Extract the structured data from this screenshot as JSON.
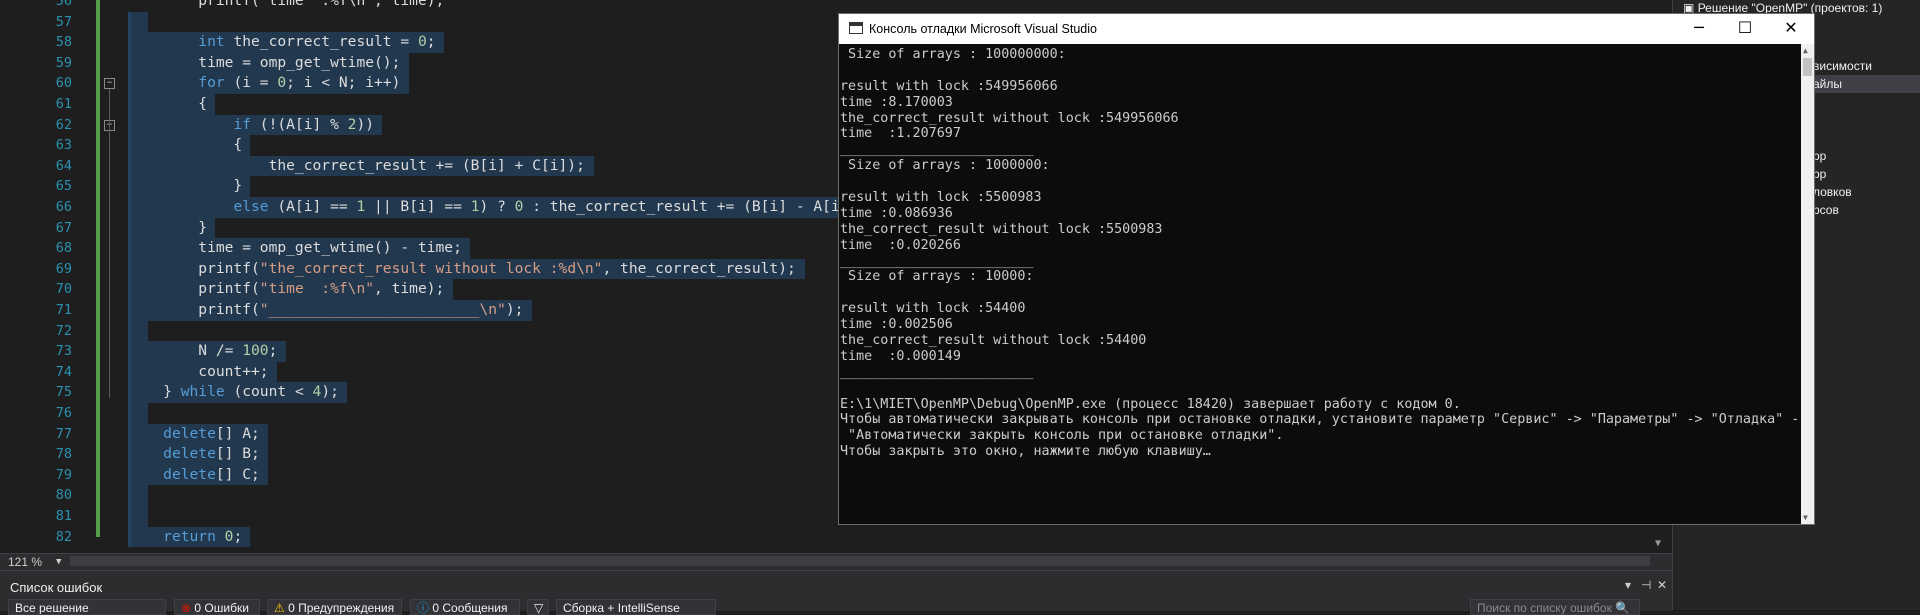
{
  "editor": {
    "lines": [
      {
        "num": "56",
        "segs": [
          {
            "t": "        printf(\"time  :%f\\n\", time);",
            "c": ""
          }
        ]
      },
      {
        "num": "57",
        "segs": [
          {
            "t": "",
            "c": ""
          }
        ]
      },
      {
        "num": "58",
        "segs": [
          {
            "t": "        ",
            "c": ""
          },
          {
            "t": "int",
            "c": "k"
          },
          {
            "t": " the_correct_result = ",
            "c": ""
          },
          {
            "t": "0",
            "c": "n"
          },
          {
            "t": ";",
            "c": ""
          }
        ]
      },
      {
        "num": "59",
        "segs": [
          {
            "t": "        time = omp_get_wtime();",
            "c": ""
          }
        ]
      },
      {
        "num": "60",
        "segs": [
          {
            "t": "        ",
            "c": ""
          },
          {
            "t": "for",
            "c": "k"
          },
          {
            "t": " (i = ",
            "c": ""
          },
          {
            "t": "0",
            "c": "n"
          },
          {
            "t": "; i < N; i++)",
            "c": ""
          }
        ]
      },
      {
        "num": "61",
        "segs": [
          {
            "t": "        {",
            "c": ""
          }
        ]
      },
      {
        "num": "62",
        "segs": [
          {
            "t": "            ",
            "c": ""
          },
          {
            "t": "if",
            "c": "k"
          },
          {
            "t": " (!(A[i] % ",
            "c": ""
          },
          {
            "t": "2",
            "c": "n"
          },
          {
            "t": "))",
            "c": ""
          }
        ]
      },
      {
        "num": "63",
        "segs": [
          {
            "t": "            {",
            "c": ""
          }
        ]
      },
      {
        "num": "64",
        "segs": [
          {
            "t": "                the_correct_result += (B[i] + C[i]);",
            "c": ""
          }
        ]
      },
      {
        "num": "65",
        "segs": [
          {
            "t": "            }",
            "c": ""
          }
        ]
      },
      {
        "num": "66",
        "segs": [
          {
            "t": "            ",
            "c": ""
          },
          {
            "t": "else",
            "c": "k"
          },
          {
            "t": " (A[i] == ",
            "c": ""
          },
          {
            "t": "1",
            "c": "n"
          },
          {
            "t": " || B[i] == ",
            "c": ""
          },
          {
            "t": "1",
            "c": "n"
          },
          {
            "t": ") ? ",
            "c": ""
          },
          {
            "t": "0",
            "c": "n"
          },
          {
            "t": " : the_correct_result += (B[i] - A[i]);",
            "c": ""
          }
        ]
      },
      {
        "num": "67",
        "segs": [
          {
            "t": "        }",
            "c": ""
          }
        ]
      },
      {
        "num": "68",
        "segs": [
          {
            "t": "        time = omp_get_wtime() - time;",
            "c": ""
          }
        ]
      },
      {
        "num": "69",
        "segs": [
          {
            "t": "        printf(",
            "c": ""
          },
          {
            "t": "\"the_correct_result without lock :%d\\n\"",
            "c": "s"
          },
          {
            "t": ", the_correct_result);",
            "c": ""
          }
        ]
      },
      {
        "num": "70",
        "segs": [
          {
            "t": "        printf(",
            "c": ""
          },
          {
            "t": "\"time  :%f\\n\"",
            "c": "s"
          },
          {
            "t": ", time);",
            "c": ""
          }
        ]
      },
      {
        "num": "71",
        "segs": [
          {
            "t": "        printf(",
            "c": ""
          },
          {
            "t": "\"________________________\\n\"",
            "c": "s"
          },
          {
            "t": ");",
            "c": ""
          }
        ]
      },
      {
        "num": "72",
        "segs": [
          {
            "t": "",
            "c": ""
          }
        ]
      },
      {
        "num": "73",
        "segs": [
          {
            "t": "        N /= ",
            "c": ""
          },
          {
            "t": "100",
            "c": "n"
          },
          {
            "t": ";",
            "c": ""
          }
        ]
      },
      {
        "num": "74",
        "segs": [
          {
            "t": "        count++;",
            "c": ""
          }
        ]
      },
      {
        "num": "75",
        "segs": [
          {
            "t": "    } ",
            "c": ""
          },
          {
            "t": "while",
            "c": "k"
          },
          {
            "t": " (count < ",
            "c": ""
          },
          {
            "t": "4",
            "c": "n"
          },
          {
            "t": ");",
            "c": ""
          }
        ]
      },
      {
        "num": "76",
        "segs": [
          {
            "t": "",
            "c": ""
          }
        ]
      },
      {
        "num": "77",
        "segs": [
          {
            "t": "    ",
            "c": ""
          },
          {
            "t": "delete",
            "c": "k"
          },
          {
            "t": "[] A;",
            "c": ""
          }
        ]
      },
      {
        "num": "78",
        "segs": [
          {
            "t": "    ",
            "c": ""
          },
          {
            "t": "delete",
            "c": "k"
          },
          {
            "t": "[] B;",
            "c": ""
          }
        ]
      },
      {
        "num": "79",
        "segs": [
          {
            "t": "    ",
            "c": ""
          },
          {
            "t": "delete",
            "c": "k"
          },
          {
            "t": "[] C;",
            "c": ""
          }
        ]
      },
      {
        "num": "80",
        "segs": [
          {
            "t": "",
            "c": ""
          }
        ]
      },
      {
        "num": "81",
        "segs": [
          {
            "t": "",
            "c": ""
          }
        ]
      },
      {
        "num": "82",
        "segs": [
          {
            "t": "    ",
            "c": ""
          },
          {
            "t": "return",
            "c": "k"
          },
          {
            "t": " ",
            "c": ""
          },
          {
            "t": "0",
            "c": "n"
          },
          {
            "t": ";",
            "c": ""
          }
        ]
      }
    ]
  },
  "status": {
    "zoom": "121 %"
  },
  "error_list": {
    "title": "Список ошибок",
    "scope": "Все решение",
    "errors": "0 Ошибки",
    "warnings": "0 Предупреждения",
    "messages": "0 Сообщения",
    "build": "Сборка + IntelliSense",
    "search_placeholder": "Поиск по списку ошибок"
  },
  "solution": {
    "header": "Решение \"OpenMP\" (проектов: 1)",
    "items": [
      "висимости",
      "айлы",
      "рр",
      "рр",
      "ловков",
      "рсов"
    ]
  },
  "console": {
    "title": "Консоль отладки Microsoft Visual Studio",
    "lines": [
      " Size of arrays : 100000000:",
      "",
      "result with lock :549956066",
      "time :8.170003",
      "the_correct_result without lock :549956066",
      "time  :1.207697",
      "________________________",
      " Size of arrays : 1000000:",
      "",
      "result with lock :5500983",
      "time :0.086936",
      "the_correct_result without lock :5500983",
      "time  :0.020266",
      "________________________",
      " Size of arrays : 10000:",
      "",
      "result with lock :54400",
      "time :0.002506",
      "the_correct_result without lock :54400",
      "time  :0.000149",
      "________________________",
      "",
      "E:\\1\\MIET\\OpenMP\\Debug\\OpenMP.exe (процесс 18420) завершает работу с кодом 0.",
      "Чтобы автоматически закрывать консоль при остановке отладки, установите параметр \"Сервис\" -> \"Параметры\" -> \"Отладка\" ->",
      " \"Автоматически закрыть консоль при остановке отладки\".",
      "Чтобы закрыть это окно, нажмите любую клавишу…"
    ]
  }
}
